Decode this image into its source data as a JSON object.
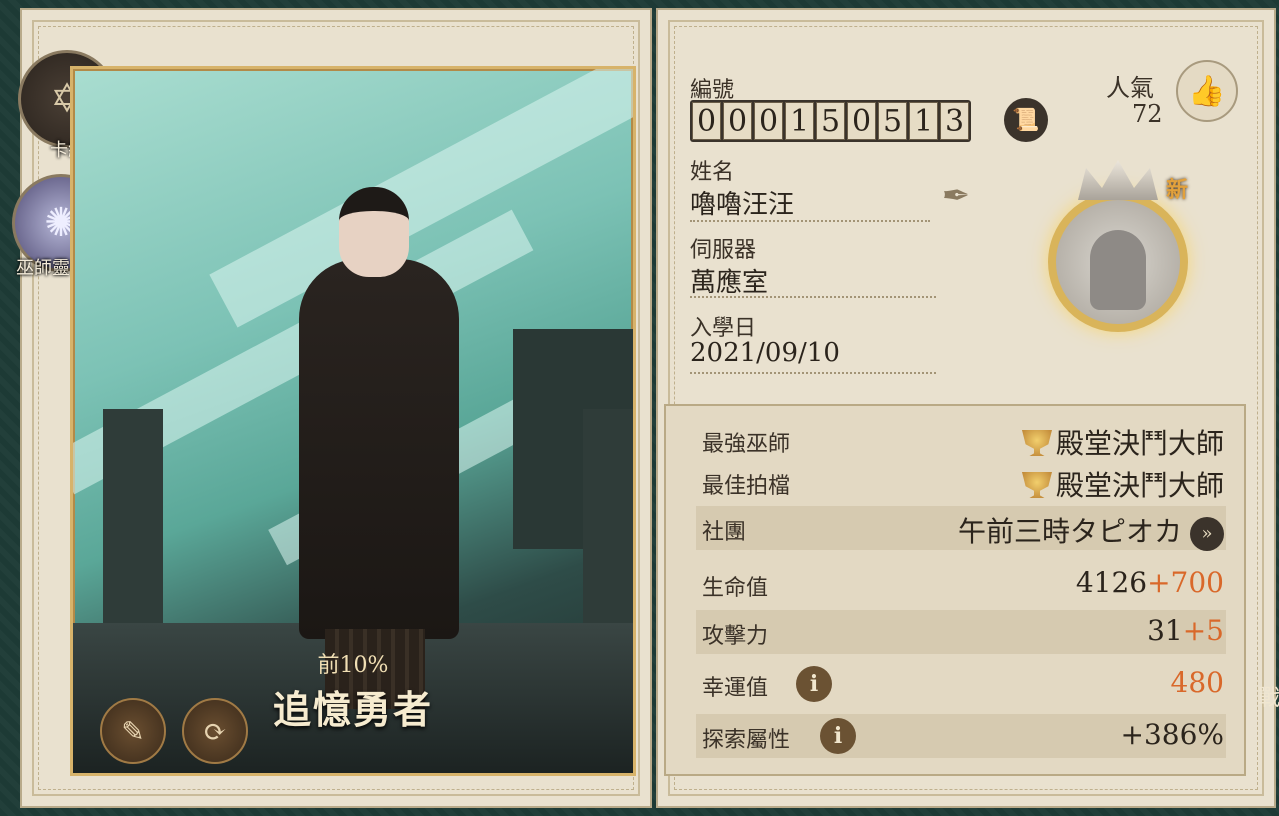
{
  "sidebar": {
    "deck_label": "卡組",
    "soul_label": "巫師靈魂"
  },
  "card": {
    "rank_percent": "前10%",
    "rank_title": "追憶勇者",
    "edit_icon": "edit-card-icon",
    "swap_icon": "refresh-icon"
  },
  "profile": {
    "id_label": "編號",
    "id_digits": [
      "0",
      "0",
      "0",
      "1",
      "5",
      "0",
      "5",
      "1",
      "3"
    ],
    "name_label": "姓名",
    "name_value": "嚕嚕汪汪",
    "server_label": "伺服器",
    "server_value": "萬應室",
    "enroll_label": "入學日",
    "enroll_value": "2021/09/10",
    "popularity_label": "人氣",
    "popularity_value": "72",
    "new_badge": "新"
  },
  "stats": {
    "best_wizard_label": "最強巫師",
    "best_wizard_value": "殿堂決鬥大師",
    "best_partner_label": "最佳拍檔",
    "best_partner_value": "殿堂決鬥大師",
    "club_label": "社團",
    "club_value": "午前三時タピオカ",
    "hp_label": "生命值",
    "hp_base": "4126",
    "hp_bonus": "+700",
    "atk_label": "攻擊力",
    "atk_base": "31",
    "atk_bonus": "+5",
    "luck_label": "幸運值",
    "luck_value": "480",
    "explore_label": "探索屬性",
    "explore_value": "+386%"
  },
  "right_tab_partial": "戰",
  "colors": {
    "bonus": "#d9682a",
    "page": "#e9e1cf",
    "gold": "#d7b36a"
  }
}
